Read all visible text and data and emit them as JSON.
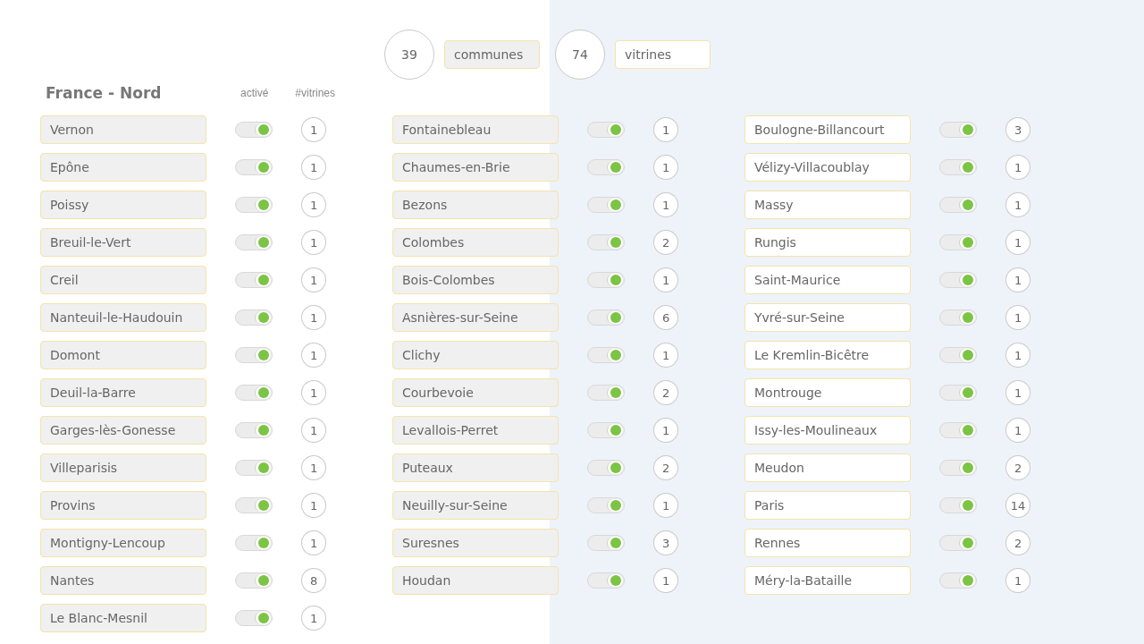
{
  "summary": {
    "communes_count": "39",
    "communes_label": "communes",
    "vitrines_count": "74",
    "vitrines_label": "vitrines"
  },
  "region": {
    "title": "France - Nord",
    "active_header": "activé",
    "count_header": "#vitrines"
  },
  "columns": [
    [
      {
        "name": "Vernon",
        "on": true,
        "count": "1"
      },
      {
        "name": "Epône",
        "on": true,
        "count": "1"
      },
      {
        "name": "Poissy",
        "on": true,
        "count": "1"
      },
      {
        "name": "Breuil-le-Vert",
        "on": true,
        "count": "1"
      },
      {
        "name": "Creil",
        "on": true,
        "count": "1"
      },
      {
        "name": "Nanteuil-le-Haudouin",
        "on": true,
        "count": "1"
      },
      {
        "name": "Domont",
        "on": true,
        "count": "1"
      },
      {
        "name": "Deuil-la-Barre",
        "on": true,
        "count": "1"
      },
      {
        "name": "Garges-lès-Gonesse",
        "on": true,
        "count": "1"
      },
      {
        "name": "Villeparisis",
        "on": true,
        "count": "1"
      },
      {
        "name": "Provins",
        "on": true,
        "count": "1"
      },
      {
        "name": "Montigny-Lencoup",
        "on": true,
        "count": "1"
      },
      {
        "name": "Nantes",
        "on": true,
        "count": "8"
      },
      {
        "name": "Le Blanc-Mesnil",
        "on": true,
        "count": "1"
      }
    ],
    [
      {
        "name": "Fontainebleau",
        "on": true,
        "count": "1"
      },
      {
        "name": "Chaumes-en-Brie",
        "on": true,
        "count": "1"
      },
      {
        "name": "Bezons",
        "on": true,
        "count": "1"
      },
      {
        "name": "Colombes",
        "on": true,
        "count": "2"
      },
      {
        "name": "Bois-Colombes",
        "on": true,
        "count": "1"
      },
      {
        "name": "Asnières-sur-Seine",
        "on": true,
        "count": "6"
      },
      {
        "name": "Clichy",
        "on": true,
        "count": "1"
      },
      {
        "name": "Courbevoie",
        "on": true,
        "count": "2"
      },
      {
        "name": "Levallois-Perret",
        "on": true,
        "count": "1"
      },
      {
        "name": "Puteaux",
        "on": true,
        "count": "2"
      },
      {
        "name": "Neuilly-sur-Seine",
        "on": true,
        "count": "1"
      },
      {
        "name": "Suresnes",
        "on": true,
        "count": "3"
      },
      {
        "name": "Houdan",
        "on": true,
        "count": "1"
      }
    ],
    [
      {
        "name": "Boulogne-Billancourt",
        "on": true,
        "count": "3"
      },
      {
        "name": "Vélizy-Villacoublay",
        "on": true,
        "count": "1"
      },
      {
        "name": "Massy",
        "on": true,
        "count": "1"
      },
      {
        "name": "Rungis",
        "on": true,
        "count": "1"
      },
      {
        "name": "Saint-Maurice",
        "on": true,
        "count": "1"
      },
      {
        "name": "Yvré-sur-Seine",
        "on": true,
        "count": "1"
      },
      {
        "name": "Le Kremlin-Bicêtre",
        "on": true,
        "count": "1"
      },
      {
        "name": "Montrouge",
        "on": true,
        "count": "1"
      },
      {
        "name": "Issy-les-Moulineaux",
        "on": true,
        "count": "1"
      },
      {
        "name": "Meudon",
        "on": true,
        "count": "2"
      },
      {
        "name": "Paris",
        "on": true,
        "count": "14"
      },
      {
        "name": "Rennes",
        "on": true,
        "count": "2"
      },
      {
        "name": "Méry-la-Bataille",
        "on": true,
        "count": "1"
      }
    ]
  ]
}
